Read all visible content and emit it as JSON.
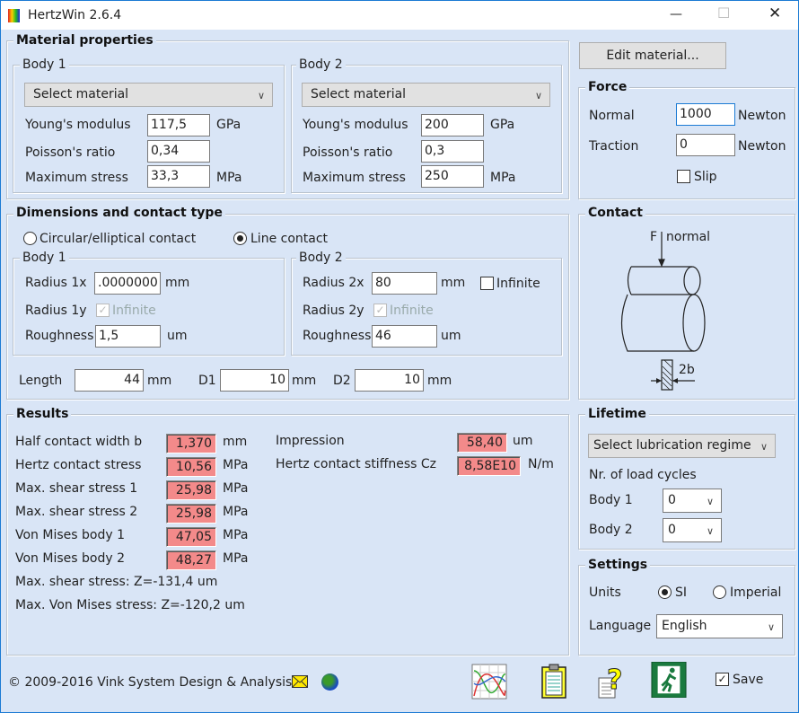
{
  "window": {
    "title": "HertzWin 2.6.4",
    "minimize": "—",
    "maximize": "☐",
    "close": "✕"
  },
  "material": {
    "title": "Material properties",
    "body1": {
      "title": "Body 1",
      "select": "Select material",
      "youngs_label": "Young's modulus",
      "youngs": "117,5",
      "youngs_unit": "GPa",
      "poisson_label": "Poisson's ratio",
      "poisson": "0,34",
      "maxstress_label": "Maximum stress",
      "maxstress": "33,3",
      "maxstress_unit": "MPa"
    },
    "body2": {
      "title": "Body 2",
      "select": "Select material",
      "youngs_label": "Young's modulus",
      "youngs": "200",
      "youngs_unit": "GPa",
      "poisson_label": "Poisson's ratio",
      "poisson": "0,3",
      "maxstress_label": "Maximum stress",
      "maxstress": "250",
      "maxstress_unit": "MPa"
    }
  },
  "edit_material": "Edit material...",
  "force": {
    "title": "Force",
    "normal_label": "Normal",
    "normal": "1000",
    "normal_unit": "Newton",
    "traction_label": "Traction",
    "traction": "0",
    "traction_unit": "Newton",
    "slip": "Slip"
  },
  "dimensions": {
    "title": "Dimensions and contact type",
    "circular": "Circular/elliptical contact",
    "line": "Line contact",
    "body1": {
      "title": "Body 1",
      "rx_label": "Radius 1x",
      "rx": ".0000000",
      "rx_unit": "mm",
      "ry_label": "Radius 1y",
      "ry_infinite": "Infinite",
      "rough_label": "Roughness",
      "rough": "1,5",
      "rough_unit": "um"
    },
    "body2": {
      "title": "Body 2",
      "rx_label": "Radius 2x",
      "rx": "80",
      "rx_unit": "mm",
      "rx_infinite": "Infinite",
      "ry_label": "Radius 2y",
      "ry_infinite": "Infinite",
      "rough_label": "Roughness",
      "rough": "46",
      "rough_unit": "um"
    },
    "length_label": "Length",
    "length": "44",
    "length_unit": "mm",
    "d1_label": "D1",
    "d1": "10",
    "d1_unit": "mm",
    "d2_label": "D2",
    "d2": "10",
    "d2_unit": "mm"
  },
  "contact": {
    "title": "Contact",
    "force_label": "F",
    "normal_label": "normal",
    "width_label": "2b"
  },
  "results": {
    "title": "Results",
    "rows": [
      {
        "label": "Half contact width b",
        "value": "1,370",
        "unit": "mm"
      },
      {
        "label": "Hertz contact stress",
        "value": "10,56",
        "unit": "MPa"
      },
      {
        "label": "Max. shear stress 1",
        "value": "25,98",
        "unit": "MPa"
      },
      {
        "label": "Max. shear stress 2",
        "value": "25,98",
        "unit": "MPa"
      },
      {
        "label": "Von Mises body 1",
        "value": "47,05",
        "unit": "MPa"
      },
      {
        "label": "Von Mises body 2",
        "value": "48,27",
        "unit": "MPa"
      }
    ],
    "impression_label": "Impression",
    "impression": "58,40",
    "impression_unit": "um",
    "stiffness_label": "Hertz contact stiffness Cz",
    "stiffness": "8,58E10",
    "stiffness_unit": "N/m",
    "max_shear_z": "Max. shear stress: Z=-131,4 um",
    "max_vm_z": "Max. Von Mises stress: Z=-120,2 um",
    "highlight_color": "#f38a8a"
  },
  "lifetime": {
    "title": "Lifetime",
    "regime": "Select lubrication regime",
    "cycles_label": "Nr. of load cycles",
    "body1_label": "Body 1",
    "body1": "0",
    "body2_label": "Body 2",
    "body2": "0"
  },
  "settings": {
    "title": "Settings",
    "units_label": "Units",
    "si": "SI",
    "imperial": "Imperial",
    "language_label": "Language",
    "language": "English"
  },
  "footer": {
    "copyright": "© 2009-2016 Vink System Design & Analysis",
    "save": "Save"
  }
}
